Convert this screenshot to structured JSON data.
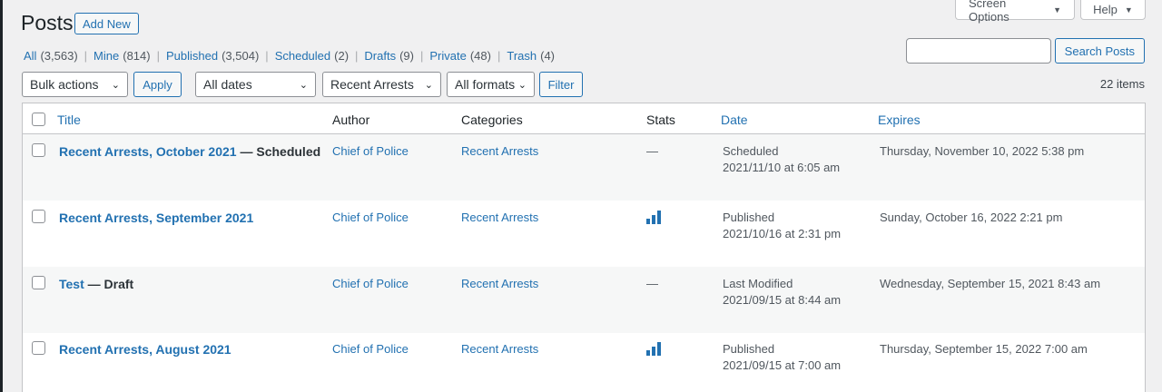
{
  "header": {
    "title": "Posts",
    "add_new": "Add New",
    "screen_options": "Screen Options",
    "help": "Help"
  },
  "views": [
    {
      "label": "All",
      "count": "(3,563)"
    },
    {
      "label": "Mine",
      "count": "(814)"
    },
    {
      "label": "Published",
      "count": "(3,504)"
    },
    {
      "label": "Scheduled",
      "count": "(2)"
    },
    {
      "label": "Drafts",
      "count": "(9)"
    },
    {
      "label": "Private",
      "count": "(48)"
    },
    {
      "label": "Trash",
      "count": "(4)"
    }
  ],
  "search": {
    "button": "Search Posts",
    "value": ""
  },
  "tablenav": {
    "bulk_actions": "Bulk actions",
    "apply": "Apply",
    "dates": "All dates",
    "category": "Recent Arrests",
    "formats": "All formats",
    "filter": "Filter",
    "items": "22 items"
  },
  "columns": {
    "title": "Title",
    "author": "Author",
    "categories": "Categories",
    "stats": "Stats",
    "date": "Date",
    "expires": "Expires"
  },
  "rows": [
    {
      "title": "Recent Arrests, October 2021",
      "state": " — Scheduled",
      "author": "Chief of Police",
      "category": "Recent Arrests",
      "stats": "—",
      "date_status": "Scheduled",
      "date_value": "2021/11/10 at 6:05 am",
      "expires": "Thursday, November 10, 2022 5:38 pm"
    },
    {
      "title": "Recent Arrests, September 2021",
      "state": "",
      "author": "Chief of Police",
      "category": "Recent Arrests",
      "stats": "",
      "date_status": "Published",
      "date_value": "2021/10/16 at 2:31 pm",
      "expires": "Sunday, October 16, 2022 2:21 pm"
    },
    {
      "title": "Test",
      "state": " — Draft",
      "author": "Chief of Police",
      "category": "Recent Arrests",
      "stats": "—",
      "date_status": "Last Modified",
      "date_value": "2021/09/15 at 8:44 am",
      "expires": "Wednesday, September 15, 2021 8:43 am"
    },
    {
      "title": "Recent Arrests, August 2021",
      "state": "",
      "author": "Chief of Police",
      "category": "Recent Arrests",
      "stats": "",
      "date_status": "Published",
      "date_value": "2021/09/15 at 7:00 am",
      "expires": "Thursday, September 15, 2022 7:00 am"
    }
  ],
  "icons": {
    "stats_chart": "bar-chart-icon",
    "dropdown": "chevron-down-icon",
    "tab_toggle": "triangle-down-icon"
  },
  "colors": {
    "link": "#2271b1",
    "text": "#3c434a",
    "background": "#f0f0f1",
    "alt_row": "#f6f7f7"
  }
}
